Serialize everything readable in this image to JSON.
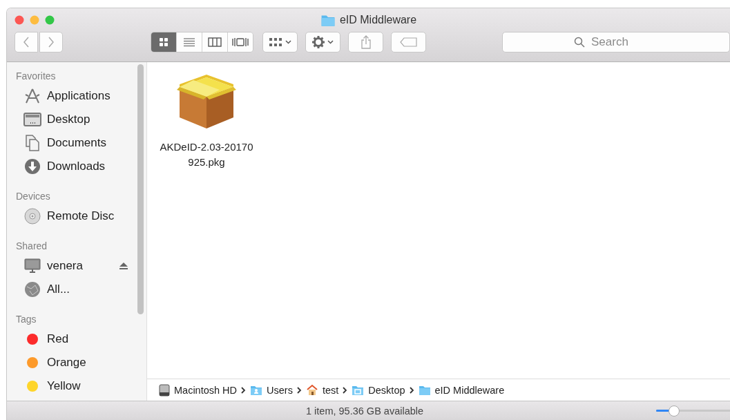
{
  "window": {
    "title": "eID Middleware"
  },
  "toolbar": {
    "view_modes": [
      {
        "kind": "icons",
        "selected": true
      },
      {
        "kind": "list",
        "selected": false
      },
      {
        "kind": "columns",
        "selected": false
      },
      {
        "kind": "coverflow",
        "selected": false
      }
    ]
  },
  "search": {
    "placeholder": "Search"
  },
  "sidebar": {
    "sections": [
      {
        "heading": "Favorites",
        "items": [
          {
            "label": "Applications",
            "kind": "applications"
          },
          {
            "label": "Desktop",
            "kind": "desktop"
          },
          {
            "label": "Documents",
            "kind": "documents"
          },
          {
            "label": "Downloads",
            "kind": "downloads"
          }
        ]
      },
      {
        "heading": "Devices",
        "items": [
          {
            "label": "Remote Disc",
            "kind": "disc"
          }
        ]
      },
      {
        "heading": "Shared",
        "items": [
          {
            "label": "venera",
            "kind": "computer",
            "ejectable": true
          },
          {
            "label": "All...",
            "kind": "network"
          }
        ]
      },
      {
        "heading": "Tags",
        "items": [
          {
            "label": "Red",
            "kind": "tag",
            "color": "#fc2b2b"
          },
          {
            "label": "Orange",
            "kind": "tag",
            "color": "#fd9a2b"
          },
          {
            "label": "Yellow",
            "kind": "tag",
            "color": "#fed52a"
          }
        ]
      }
    ]
  },
  "files": [
    {
      "name": "AKDeID-2.03-20170925.pkg",
      "kind": "package"
    }
  ],
  "path_bar": [
    {
      "label": "Macintosh HD",
      "kind": "disk"
    },
    {
      "label": "Users",
      "kind": "users"
    },
    {
      "label": "test",
      "kind": "home"
    },
    {
      "label": "Desktop",
      "kind": "desktop"
    },
    {
      "label": "eID Middleware",
      "kind": "folder"
    }
  ],
  "status_bar": {
    "text": "1 item, 95.36 GB available",
    "zoom": {
      "level": 0.24
    }
  }
}
